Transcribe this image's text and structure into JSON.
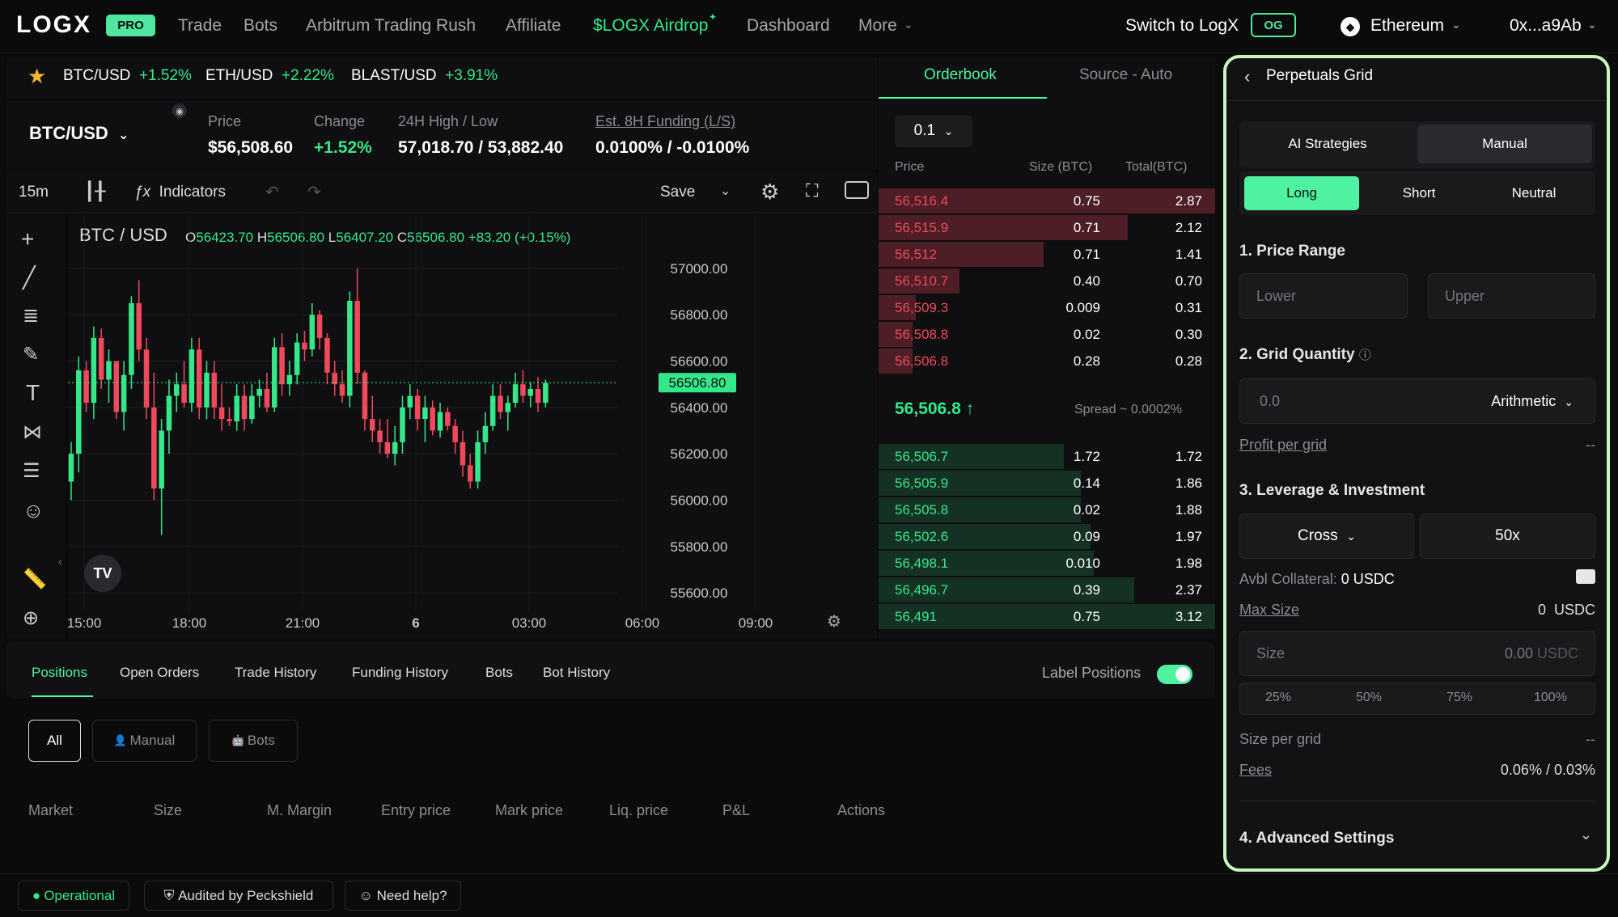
{
  "nav": {
    "logo": "LOGX",
    "pro": "PRO",
    "items": [
      "Trade",
      "Bots",
      "Arbitrum Trading Rush",
      "Affiliate",
      "$LOGX Airdrop",
      "Dashboard",
      "More"
    ],
    "switch": "Switch to LogX",
    "og": "OG",
    "network": "Ethereum",
    "wallet": "0x...a9Ab"
  },
  "ticker": [
    {
      "pair": "BTC/USD",
      "change": "+1.52%"
    },
    {
      "pair": "ETH/USD",
      "change": "+2.22%"
    },
    {
      "pair": "BLAST/USD",
      "change": "+3.91%"
    }
  ],
  "market": {
    "pair": "BTC/USD",
    "price_label": "Price",
    "price": "$56,508.60",
    "change_label": "Change",
    "change": "+1.52%",
    "hl_label": "24H High / Low",
    "hl": "57,018.70 / 53,882.40",
    "funding_label": "Est. 8H Funding (L/S)",
    "funding": "0.0100% / -0.0100%"
  },
  "toolbar": {
    "interval": "15m",
    "indicators": "Indicators",
    "save": "Save"
  },
  "chart_data": {
    "type": "candlestick",
    "symbol": "BTC / USD",
    "ohlc": {
      "o": "56423.70",
      "h": "56506.80",
      "l": "56407.20",
      "c": "56506.80",
      "chg": "+83.20 (+0.15%)"
    },
    "yticks": [
      "57000.00",
      "56800.00",
      "56600.00",
      "56400.00",
      "56200.00",
      "56000.00",
      "55800.00",
      "55600.00"
    ],
    "ylim": [
      55520,
      57230
    ],
    "xticks": [
      "15:00",
      "18:00",
      "21:00",
      "6",
      "03:00",
      "06:00",
      "09:00"
    ],
    "last_price": "56506.80",
    "candles": [
      [
        55680,
        56080,
        55600,
        55700
      ],
      [
        56080,
        56250,
        56000,
        56200
      ],
      [
        56200,
        56620,
        56120,
        56560
      ],
      [
        56560,
        56600,
        56380,
        56420
      ],
      [
        56420,
        56750,
        56350,
        56700
      ],
      [
        56700,
        56740,
        56480,
        56520
      ],
      [
        56520,
        56650,
        56420,
        56600
      ],
      [
        56600,
        56600,
        56350,
        56380
      ],
      [
        56380,
        56600,
        56300,
        56540
      ],
      [
        56540,
        56880,
        56480,
        56850
      ],
      [
        56850,
        56950,
        56600,
        56650
      ],
      [
        56650,
        56700,
        56350,
        56400
      ],
      [
        56400,
        56550,
        56000,
        56050
      ],
      [
        56050,
        56350,
        55850,
        56300
      ],
      [
        56300,
        56520,
        56200,
        56450
      ],
      [
        56450,
        56550,
        56380,
        56500
      ],
      [
        56500,
        56600,
        56400,
        56420
      ],
      [
        56420,
        56700,
        56380,
        56650
      ],
      [
        56650,
        56700,
        56350,
        56400
      ],
      [
        56400,
        56600,
        56350,
        56550
      ],
      [
        56550,
        56600,
        56350,
        56400
      ],
      [
        56400,
        56500,
        56300,
        56350
      ],
      [
        56350,
        56400,
        56320,
        56340
      ],
      [
        56340,
        56500,
        56300,
        56450
      ],
      [
        56450,
        56500,
        56300,
        56350
      ],
      [
        56350,
        56500,
        56330,
        56450
      ],
      [
        56450,
        56520,
        56400,
        56480
      ],
      [
        56480,
        56550,
        56380,
        56400
      ],
      [
        56400,
        56700,
        56380,
        56660
      ],
      [
        56660,
        56720,
        56450,
        56500
      ],
      [
        56500,
        56600,
        56450,
        56540
      ],
      [
        56540,
        56720,
        56500,
        56680
      ],
      [
        56680,
        56730,
        56600,
        56650
      ],
      [
        56650,
        56850,
        56620,
        56800
      ],
      [
        56800,
        56820,
        56650,
        56700
      ],
      [
        56700,
        56720,
        56500,
        56550
      ],
      [
        56550,
        56600,
        56450,
        56500
      ],
      [
        56500,
        56560,
        56420,
        56450
      ],
      [
        56450,
        56900,
        56400,
        56860
      ],
      [
        56860,
        57000,
        56500,
        56550
      ],
      [
        56550,
        56560,
        56300,
        56350
      ],
      [
        56350,
        56450,
        56250,
        56300
      ],
      [
        56300,
        56350,
        56200,
        56250
      ],
      [
        56250,
        56350,
        56180,
        56200
      ],
      [
        56200,
        56320,
        56150,
        56250
      ],
      [
        56250,
        56450,
        56200,
        56400
      ],
      [
        56400,
        56500,
        56350,
        56450
      ],
      [
        56450,
        56480,
        56300,
        56350
      ],
      [
        56350,
        56450,
        56250,
        56400
      ],
      [
        56400,
        56430,
        56280,
        56300
      ],
      [
        56300,
        56420,
        56270,
        56380
      ],
      [
        56380,
        56400,
        56300,
        56320
      ],
      [
        56320,
        56350,
        56200,
        56250
      ],
      [
        56250,
        56300,
        56100,
        56150
      ],
      [
        56150,
        56200,
        56050,
        56080
      ],
      [
        56080,
        56300,
        56050,
        56250
      ],
      [
        56250,
        56380,
        56200,
        56320
      ],
      [
        56320,
        56500,
        56300,
        56450
      ],
      [
        56450,
        56500,
        56350,
        56380
      ],
      [
        56380,
        56450,
        56300,
        56420
      ],
      [
        56420,
        56550,
        56400,
        56500
      ],
      [
        56500,
        56560,
        56420,
        56450
      ],
      [
        56450,
        56510,
        56400,
        56480
      ],
      [
        56480,
        56530,
        56380,
        56420
      ],
      [
        56420,
        56520,
        56400,
        56506
      ]
    ]
  },
  "orderbook": {
    "tabs": [
      "Orderbook",
      "Source - Auto"
    ],
    "step": "0.1",
    "headers": [
      "Price",
      "Size (BTC)",
      "Total(BTC)"
    ],
    "asks": [
      {
        "price": "56,516.4",
        "size": "0.75",
        "total": "2.87",
        "depth": 1.0
      },
      {
        "price": "56,515.9",
        "size": "0.71",
        "total": "2.12",
        "depth": 0.74
      },
      {
        "price": "56,512",
        "size": "0.71",
        "total": "1.41",
        "depth": 0.49
      },
      {
        "price": "56,510.7",
        "size": "0.40",
        "total": "0.70",
        "depth": 0.24
      },
      {
        "price": "56,509.3",
        "size": "0.009",
        "total": "0.31",
        "depth": 0.11
      },
      {
        "price": "56,508.8",
        "size": "0.02",
        "total": "0.30",
        "depth": 0.1
      },
      {
        "price": "56,506.8",
        "size": "0.28",
        "total": "0.28",
        "depth": 0.1
      }
    ],
    "mid": "56,506.8 ↑",
    "spread": "Spread ~ 0.0002%",
    "bids": [
      {
        "price": "56,506.7",
        "size": "1.72",
        "total": "1.72",
        "depth": 0.55
      },
      {
        "price": "56,505.9",
        "size": "0.14",
        "total": "1.86",
        "depth": 0.6
      },
      {
        "price": "56,505.8",
        "size": "0.02",
        "total": "1.88",
        "depth": 0.6
      },
      {
        "price": "56,502.6",
        "size": "0.09",
        "total": "1.97",
        "depth": 0.63
      },
      {
        "price": "56,498.1",
        "size": "0.010",
        "total": "1.98",
        "depth": 0.64
      },
      {
        "price": "56,496.7",
        "size": "0.39",
        "total": "2.37",
        "depth": 0.76
      },
      {
        "price": "56,491",
        "size": "0.75",
        "total": "3.12",
        "depth": 1.0
      }
    ]
  },
  "bottom": {
    "tabs": [
      "Positions",
      "Open Orders",
      "Trade History",
      "Funding History",
      "Bots",
      "Bot History"
    ],
    "label_positions": "Label Positions",
    "filters": [
      "All",
      "Manual",
      "Bots"
    ],
    "columns": [
      "Market",
      "Size",
      "M. Margin",
      "Entry price",
      "Mark price",
      "Liq. price",
      "P&L",
      "Actions"
    ]
  },
  "status": {
    "operational": "Operational",
    "audited": "Audited by Peckshield",
    "help": "Need help?"
  },
  "grid": {
    "title": "Perpetuals Grid",
    "modes": [
      "AI Strategies",
      "Manual"
    ],
    "sides": [
      "Long",
      "Short",
      "Neutral"
    ],
    "s1": "1. Price Range",
    "lower": "Lower",
    "upper": "Upper",
    "s2": "2. Grid Quantity",
    "qty": "0.0",
    "qty_mode": "Arithmetic",
    "profit_label": "Profit per grid",
    "profit": "--",
    "s3": "3. Leverage & Investment",
    "margin_mode": "Cross",
    "leverage": "50x",
    "collateral_label": "Avbl Collateral:",
    "collateral": "0 USDC",
    "max_label": "Max Size",
    "max": "0  USDC",
    "size_label": "Size",
    "size_val": "0.00",
    "size_unit": "USDC",
    "pcts": [
      "25%",
      "50%",
      "75%",
      "100%"
    ],
    "spg_label": "Size per grid",
    "spg": "--",
    "fees_label": "Fees",
    "fees": "0.06% / 0.03%",
    "s4": "4. Advanced Settings"
  },
  "colors": {
    "up": "#34e88a",
    "down": "#f0495b",
    "accent": "#4ff2a0",
    "panel_border": "#c9f5c0"
  }
}
